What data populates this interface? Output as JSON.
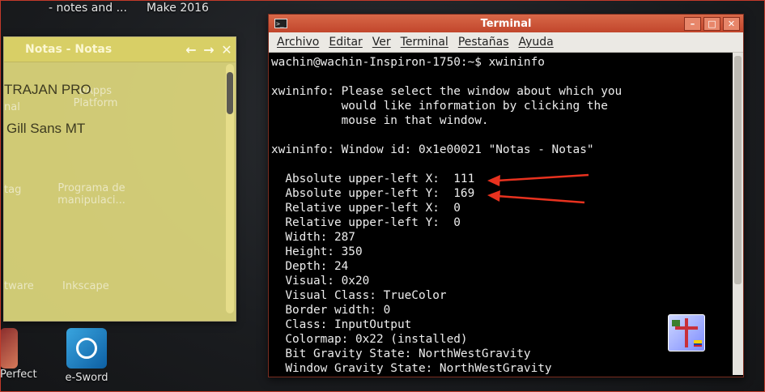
{
  "desktop": {
    "top_labels": [
      "- notes and ...",
      "Make 2016"
    ],
    "icons": [
      {
        "label": "nal"
      },
      {
        "label": "eApps Platform"
      },
      {
        "label": "tag"
      },
      {
        "label": "Programa de manipulaci..."
      },
      {
        "label": "tware"
      },
      {
        "label": "Inkscape"
      },
      {
        "label": "Perfect"
      },
      {
        "label": "e-Sword"
      }
    ]
  },
  "notes": {
    "title": "Notas - Notas",
    "lines": [
      "TRAJAN PRO",
      "Gill Sans MT"
    ]
  },
  "terminal": {
    "title": "Terminal",
    "menu": [
      "Archivo",
      "Editar",
      "Ver",
      "Terminal",
      "Pestañas",
      "Ayuda"
    ],
    "output": "wachin@wachin-Inspiron-1750:~$ xwininfo\n\nxwininfo: Please select the window about which you\n          would like information by clicking the\n          mouse in that window.\n\nxwininfo: Window id: 0x1e00021 \"Notas - Notas\"\n\n  Absolute upper-left X:  111\n  Absolute upper-left Y:  169\n  Relative upper-left X:  0\n  Relative upper-left Y:  0\n  Width: 287\n  Height: 350\n  Depth: 24\n  Visual: 0x20\n  Visual Class: TrueColor\n  Border width: 0\n  Class: InputOutput\n  Colormap: 0x22 (installed)\n  Bit Gravity State: NorthWestGravity\n  Window Gravity State: NorthWestGravity"
  },
  "colors": {
    "accent_red": "#e8321f",
    "notes_yellow": "#e9e282",
    "terminal_bg": "#000000"
  }
}
